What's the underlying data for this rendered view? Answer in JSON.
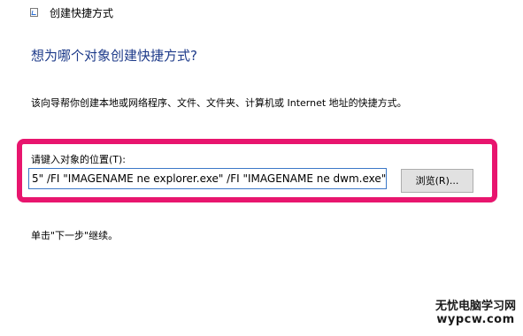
{
  "window": {
    "title": "创建快捷方式",
    "icon": "shortcut-icon"
  },
  "main": {
    "heading": "想为哪个对象创建快捷方式?",
    "description": "该向导帮你创建本地或网络程序、文件、文件夹、计算机或 Internet 地址的快捷方式。",
    "location_label": "请键入对象的位置(T):",
    "location_value": "5\" /FI \"IMAGENAME ne explorer.exe\" /FI \"IMAGENAME ne dwm.exe\"",
    "browse_label": "浏览(R)...",
    "hint": "单击\"下一步\"继续。"
  },
  "watermark": {
    "line1": "无忧电脑学习网",
    "line2": "wypcw.com"
  },
  "colors": {
    "highlight": "#e8156e",
    "heading": "#1e3b8a",
    "input_border": "#3c78c8"
  }
}
